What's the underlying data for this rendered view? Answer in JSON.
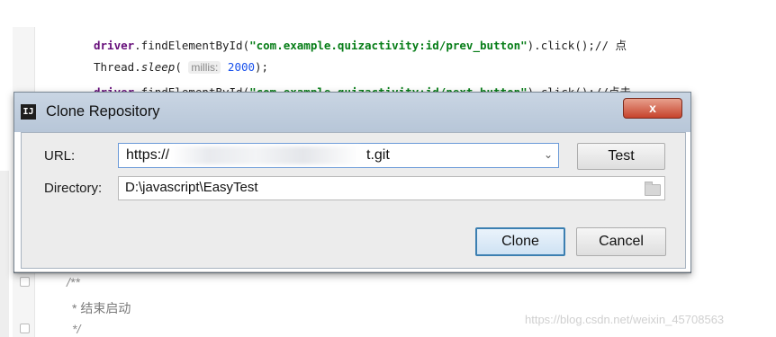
{
  "editor": {
    "line1": {
      "prefix": "driver",
      "call": ".findElementById(",
      "arg": "\"com.example.quizactivity:id/prev_button\"",
      "suffix": ").click();// 点"
    },
    "line2": {
      "prefix": "Thread.",
      "method": "sleep",
      "open": "(",
      "hint": "millis:",
      "value": "2000",
      "close": ");"
    },
    "line3": {
      "prefix": "driver",
      "call": ".findElementById(",
      "arg": "\"com.example.quizactivity:id/next_button\"",
      "suffix": ").click();//点击"
    },
    "comment_open": "/**",
    "comment_text": "* 结束启动",
    "comment_close": "*/"
  },
  "dialog": {
    "title": "Clone Repository",
    "close_label": "x",
    "url_label": "URL:",
    "url_prefix": "https://",
    "url_suffix": "t.git",
    "directory_label": "Directory:",
    "directory_value": "D:\\javascript\\EasyTest",
    "test_label": "Test",
    "clone_label": "Clone",
    "cancel_label": "Cancel"
  },
  "watermark": "https://blog.csdn.net/weixin_45708563",
  "icons": {
    "app": "intellij-icon",
    "close": "close-icon",
    "dropdown": "chevron-down-icon",
    "browse": "folder-icon"
  }
}
